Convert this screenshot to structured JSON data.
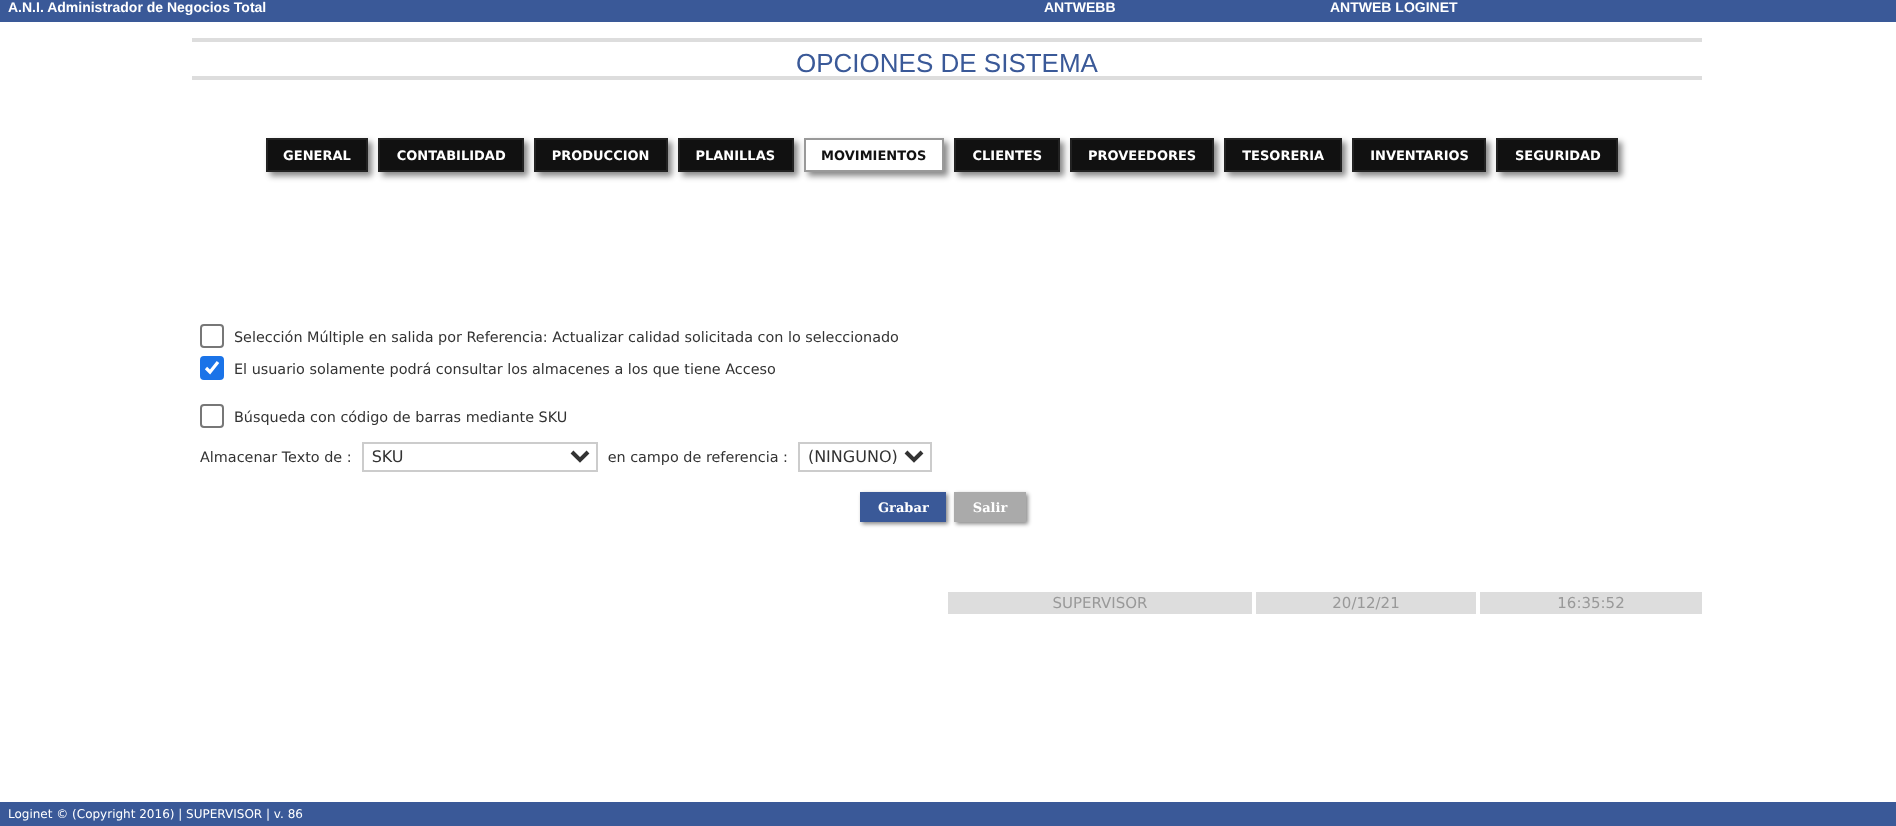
{
  "header": {
    "app_name": "A.N.I. Administrador de Negocios Total",
    "server": "ANTWEBB",
    "company": "ANTWEB LOGINET"
  },
  "title": "OPCIONES DE SISTEMA",
  "tabs": [
    {
      "label": "GENERAL",
      "selected": false
    },
    {
      "label": "CONTABILIDAD",
      "selected": false
    },
    {
      "label": "PRODUCCION",
      "selected": false
    },
    {
      "label": "PLANILLAS",
      "selected": false
    },
    {
      "label": "MOVIMIENTOS",
      "selected": true
    },
    {
      "label": "CLIENTES",
      "selected": false
    },
    {
      "label": "PROVEEDORES",
      "selected": false
    },
    {
      "label": "TESORERIA",
      "selected": false
    },
    {
      "label": "INVENTARIOS",
      "selected": false
    },
    {
      "label": "SEGURIDAD",
      "selected": false
    }
  ],
  "options": [
    {
      "label": "Selección Múltiple en salida por Referencia: Actualizar calidad solicitada con lo seleccionado",
      "checked": false
    },
    {
      "label": "El usuario solamente podrá consultar los almacenes a los que tiene Acceso",
      "checked": true
    },
    {
      "label": "Búsqueda con código de barras mediante SKU",
      "checked": false
    }
  ],
  "store_text": {
    "label": "Almacenar Texto de :",
    "value": "SKU",
    "ref_label": "en campo de referencia :",
    "ref_value": "(NINGUNO)"
  },
  "buttons": [
    {
      "label": "Grabar",
      "disabled": false
    },
    {
      "label": "Salir",
      "disabled": true
    }
  ],
  "status": [
    "SUPERVISOR",
    "20/12/21",
    "16:35:52"
  ],
  "footer": "Loginet © (Copyright 2016) | SUPERVISOR | v. 86"
}
